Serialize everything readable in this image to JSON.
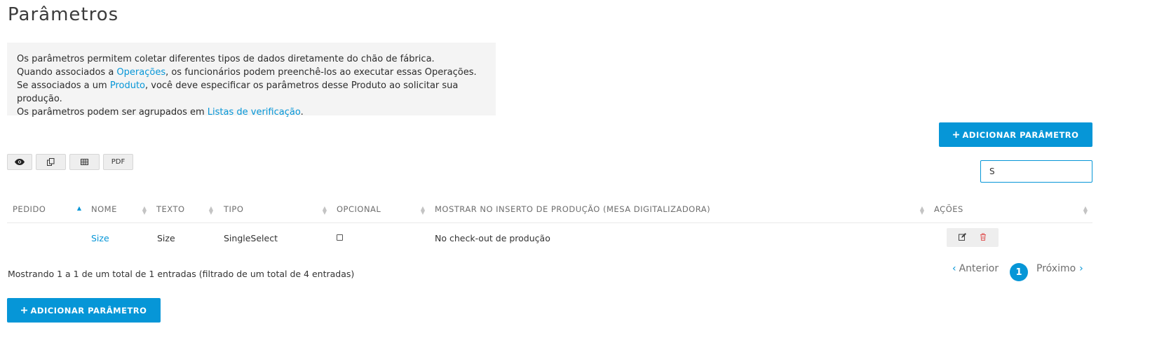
{
  "page": {
    "title": "Parâmetros"
  },
  "info": {
    "line1": "Os parâmetros permitem coletar diferentes tipos de dados diretamente do chão de fábrica.",
    "line2_pre": "Quando associados a ",
    "line2_link": "Operações",
    "line2_post": ", os funcionários podem preenchê-los ao executar essas Operações.",
    "line3_pre": "Se associados a um ",
    "line3_link": "Produto",
    "line3_post": ", você deve especificar os parâmetros desse Produto ao solicitar sua produção.",
    "line4_pre": "Os parâmetros podem ser agrupados em ",
    "line4_link": "Listas de verificação",
    "line4_post": "."
  },
  "actions": {
    "add_label": "ADICIONAR PARÂMETRO",
    "add_icon": "plus-icon"
  },
  "toolbar": {
    "view_icon": "eye-icon",
    "copy_icon": "copy-icon",
    "excel_icon": "table-icon",
    "pdf_label": "PDF"
  },
  "search": {
    "value": "S",
    "placeholder": ""
  },
  "table": {
    "columns": [
      "PEDIDO",
      "NOME",
      "TEXTO",
      "TIPO",
      "OPCIONAL",
      "MOSTRAR NO INSERTO DE PRODUÇÃO (MESA DIGITALIZADORA)",
      "AÇÕES"
    ],
    "sorted_column": "PEDIDO",
    "sort_direction": "ascending",
    "rows": [
      {
        "pedido": "",
        "nome": "Size",
        "texto": "Size",
        "tipo": "SingleSelect",
        "opcional": false,
        "mostrar": "No check-out de produção",
        "actions": [
          "edit-icon",
          "trash-icon"
        ]
      }
    ]
  },
  "footer": {
    "info": "Mostrando 1 a 1 de um total de 1 entradas (filtrado de um total de 4 entradas)",
    "prev_label": "Anterior",
    "next_label": "Próximo",
    "current_page": "1"
  },
  "colors": {
    "accent": "#0696d7",
    "delete": "#e05a5a"
  }
}
